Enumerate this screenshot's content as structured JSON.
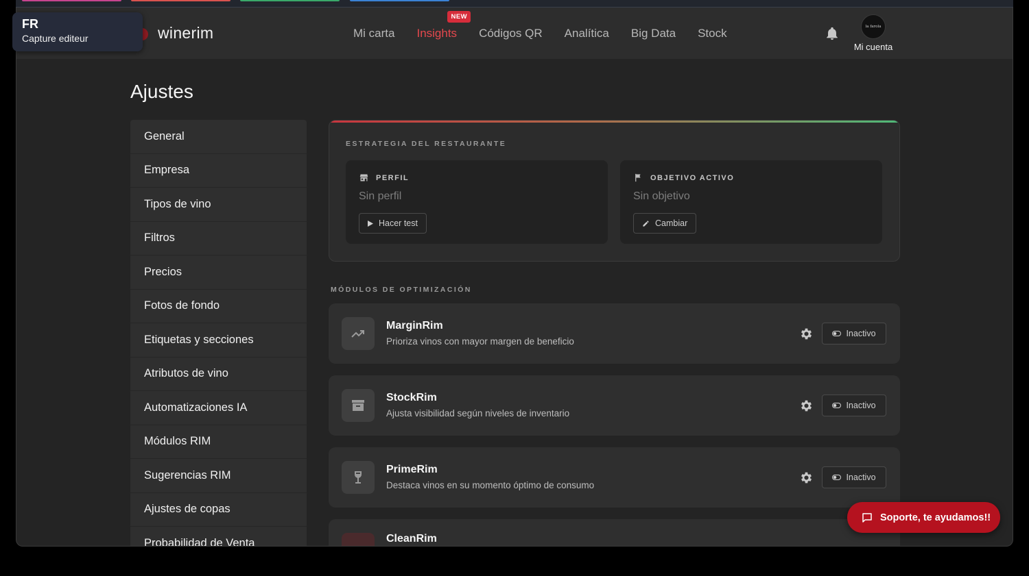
{
  "overlay": {
    "code": "FR",
    "label": "Capture editeur"
  },
  "brand": {
    "name": "winerim"
  },
  "nav": {
    "items": [
      {
        "label": "Mi carta"
      },
      {
        "label": "Insights",
        "badge": "NEW"
      },
      {
        "label": "Códigos QR"
      },
      {
        "label": "Analítica"
      },
      {
        "label": "Big Data"
      },
      {
        "label": "Stock"
      }
    ],
    "active": "Insights"
  },
  "account": {
    "label": "Mi cuenta",
    "avatar_text": "la farola"
  },
  "page": {
    "title": "Ajustes"
  },
  "sidebar": {
    "items": [
      {
        "label": "General"
      },
      {
        "label": "Empresa"
      },
      {
        "label": "Tipos de vino"
      },
      {
        "label": "Filtros"
      },
      {
        "label": "Precios"
      },
      {
        "label": "Fotos de fondo"
      },
      {
        "label": "Etiquetas y secciones"
      },
      {
        "label": "Atributos de vino"
      },
      {
        "label": "Automatizaciones IA"
      },
      {
        "label": "Módulos RIM"
      },
      {
        "label": "Sugerencias RIM"
      },
      {
        "label": "Ajustes de copas"
      },
      {
        "label": "Probabilidad de Venta"
      }
    ]
  },
  "strategy": {
    "section_label": "ESTRATEGIA DEL RESTAURANTE",
    "profile": {
      "header": "PERFIL",
      "value": "Sin perfil",
      "button": "Hacer test",
      "icon": "store-icon"
    },
    "objective": {
      "header": "OBJETIVO ACTIVO",
      "value": "Sin objetivo",
      "button": "Cambiar",
      "icon": "flag-icon"
    }
  },
  "modules": {
    "section_label": "MÓDULOS DE OPTIMIZACIÓN",
    "items": [
      {
        "title": "MarginRim",
        "desc": "Prioriza vinos con mayor margen de beneficio",
        "status": "Inactivo",
        "icon": "trending-up-icon"
      },
      {
        "title": "StockRim",
        "desc": "Ajusta visibilidad según niveles de inventario",
        "status": "Inactivo",
        "icon": "archive-box-icon"
      },
      {
        "title": "PrimeRim",
        "desc": "Destaca vinos en su momento óptimo de consumo",
        "status": "Inactivo",
        "icon": "wine-glass-icon"
      },
      {
        "title": "CleanRim",
        "desc": "",
        "status": "",
        "icon": ""
      }
    ]
  },
  "support": {
    "label": "Soporte, te ayudamos!!"
  },
  "colors": {
    "accent": "#e5484d",
    "support_bg": "#b5121f",
    "page_bg": "#242424",
    "card_bg": "#2f2f2f"
  }
}
